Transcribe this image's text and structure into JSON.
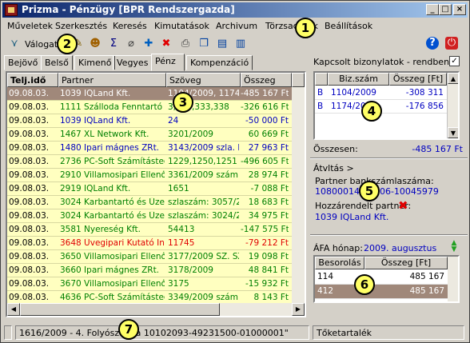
{
  "window": {
    "title": "Prizma - Pénzügy [BPR Rendszergazda]",
    "controls": {
      "minimize": "_",
      "maximize": "□",
      "close": "×"
    }
  },
  "menu": [
    "Műveletek",
    "Szerkesztés",
    "Keresés",
    "Kimutatások",
    "Archivum",
    "Törzsadatok",
    "Beállítások"
  ],
  "toolbar": {
    "filter_label": "Válogatás",
    "icons": [
      "filter-icon",
      "edit-icon",
      "user-icon",
      "sum-icon",
      "attach-icon",
      "add-icon",
      "delete-icon",
      "print-icon",
      "copy-icon",
      "export-icon",
      "import-icon",
      "help-icon",
      "power-icon"
    ]
  },
  "tabs": [
    "Bejövő",
    "Belső",
    "Kimenő",
    "Vegyes",
    "Pénz",
    "Kompenzáció"
  ],
  "active_tab": "Pénz",
  "grid": {
    "headers": [
      "Telj.idő",
      "Partner",
      "Szöveg",
      "Összeg"
    ],
    "rows": [
      {
        "date": "09.08.03.",
        "partner": "1039 IQLand Kft.",
        "text": "1104/2009, 1174/2",
        "amount": "-485 167 Ft",
        "selected": true,
        "color": "#ffffff"
      },
      {
        "date": "09.08.03.",
        "partner": "1111 Szálloda Fenntartó Vá",
        "text": "3,333,333,338",
        "amount": "-326 616 Ft",
        "color": "#008000"
      },
      {
        "date": "09.08.03.",
        "partner": "1039 IQLand Kft.",
        "text": "24",
        "amount": "-50 000 Ft",
        "color": "#0000c0"
      },
      {
        "date": "09.08.03.",
        "partner": "1467 XL Network Kft.",
        "text": "3201/2009",
        "amount": "60 669 Ft",
        "color": "#008000"
      },
      {
        "date": "09.08.03.",
        "partner": "1480 Ipari mágnes ZRt.",
        "text": "3143/2009 szla. ki",
        "amount": "27 963 Ft",
        "color": "#0000c0"
      },
      {
        "date": "09.08.03.",
        "partner": "2736 PC-Soft Számítástech",
        "text": "1229,1250,1251",
        "amount": "-496 605 Ft",
        "color": "#008000"
      },
      {
        "date": "09.08.03.",
        "partner": "2910 Villamosipari Ellenőrző",
        "text": "3361/2009 számla",
        "amount": "28 974 Ft",
        "color": "#008000"
      },
      {
        "date": "09.08.03.",
        "partner": "2919 IQLand Kft.",
        "text": "1651",
        "amount": "-7 088 Ft",
        "color": "#008000"
      },
      {
        "date": "09.08.03.",
        "partner": "3024 Karbantartó és Üzemel",
        "text": "szlaszám: 3057/20",
        "amount": "18 683 Ft",
        "color": "#008000"
      },
      {
        "date": "09.08.03.",
        "partner": "3024 Karbantartó és Üzemel",
        "text": "szlaszám: 3024/20",
        "amount": "34 975 Ft",
        "color": "#008000"
      },
      {
        "date": "09.08.03.",
        "partner": "3581 Nyereség Kft.",
        "text": "54413",
        "amount": "-147 575 Ft",
        "color": "#008000"
      },
      {
        "date": "09.08.03.",
        "partner": "3648 Üvegipari Kutató Intéz",
        "text": "11745",
        "amount": "-79 212 Ft",
        "color": "#e00000"
      },
      {
        "date": "09.08.03.",
        "partner": "3650 Villamosipari Ellenőrző",
        "text": "3177/2009 SZ. SZ",
        "amount": "19 098 Ft",
        "color": "#008000"
      },
      {
        "date": "09.08.03.",
        "partner": "3660 Ipari mágnes ZRt.",
        "text": "3178/2009",
        "amount": "48 841 Ft",
        "color": "#008000"
      },
      {
        "date": "09.08.03.",
        "partner": "3670 Villamosipari Ellenőrző",
        "text": "3175",
        "amount": "-15 932 Ft",
        "color": "#008000"
      },
      {
        "date": "09.08.03.",
        "partner": "4636 PC-Soft Számítástech",
        "text": "3349/2009 számla",
        "amount": "8 143 Ft",
        "color": "#008000"
      }
    ]
  },
  "linked": {
    "title": "Kapcsolt bizonylatok - rendben:",
    "checked": "✓",
    "headers": [
      "Biz.szám",
      "Összeg [Ft]"
    ],
    "rows": [
      {
        "type": "B",
        "num": "1104/2009",
        "amount": "-308 311"
      },
      {
        "type": "B",
        "num": "1174/2009",
        "amount": "-176 856"
      }
    ],
    "total_label": "Összesen:",
    "total_value": "-485 167 Ft"
  },
  "transfer": {
    "title": "Átvltás >",
    "bank_label": "Partner bankszámlaszáma:",
    "bank_value": "10800014-70106-10045979",
    "assigned_label": "Hozzárendelt partner:",
    "assigned_value": "1039 IQLand Kft."
  },
  "vat": {
    "label": "ÁFA hónap:",
    "month": "2009. augusztus",
    "headers": [
      "Besorolás",
      "Összeg [Ft]"
    ],
    "rows": [
      {
        "code": "114",
        "amount": "485 167",
        "selected": false
      },
      {
        "code": "412",
        "amount": "485 167",
        "selected": true
      }
    ]
  },
  "status": {
    "left": "1616/2009 - 4. Folyószámla 10102093-49231500-01000001\"",
    "right": "Tőketartalék"
  },
  "callouts": [
    "1",
    "2",
    "3",
    "4",
    "5",
    "6",
    "7"
  ],
  "colors": {
    "title_start": "#0a246a",
    "title_end": "#a6caf0",
    "row_bg": "#ffffc0",
    "row_selected": "#a0887a",
    "callout": "#ffff66"
  }
}
